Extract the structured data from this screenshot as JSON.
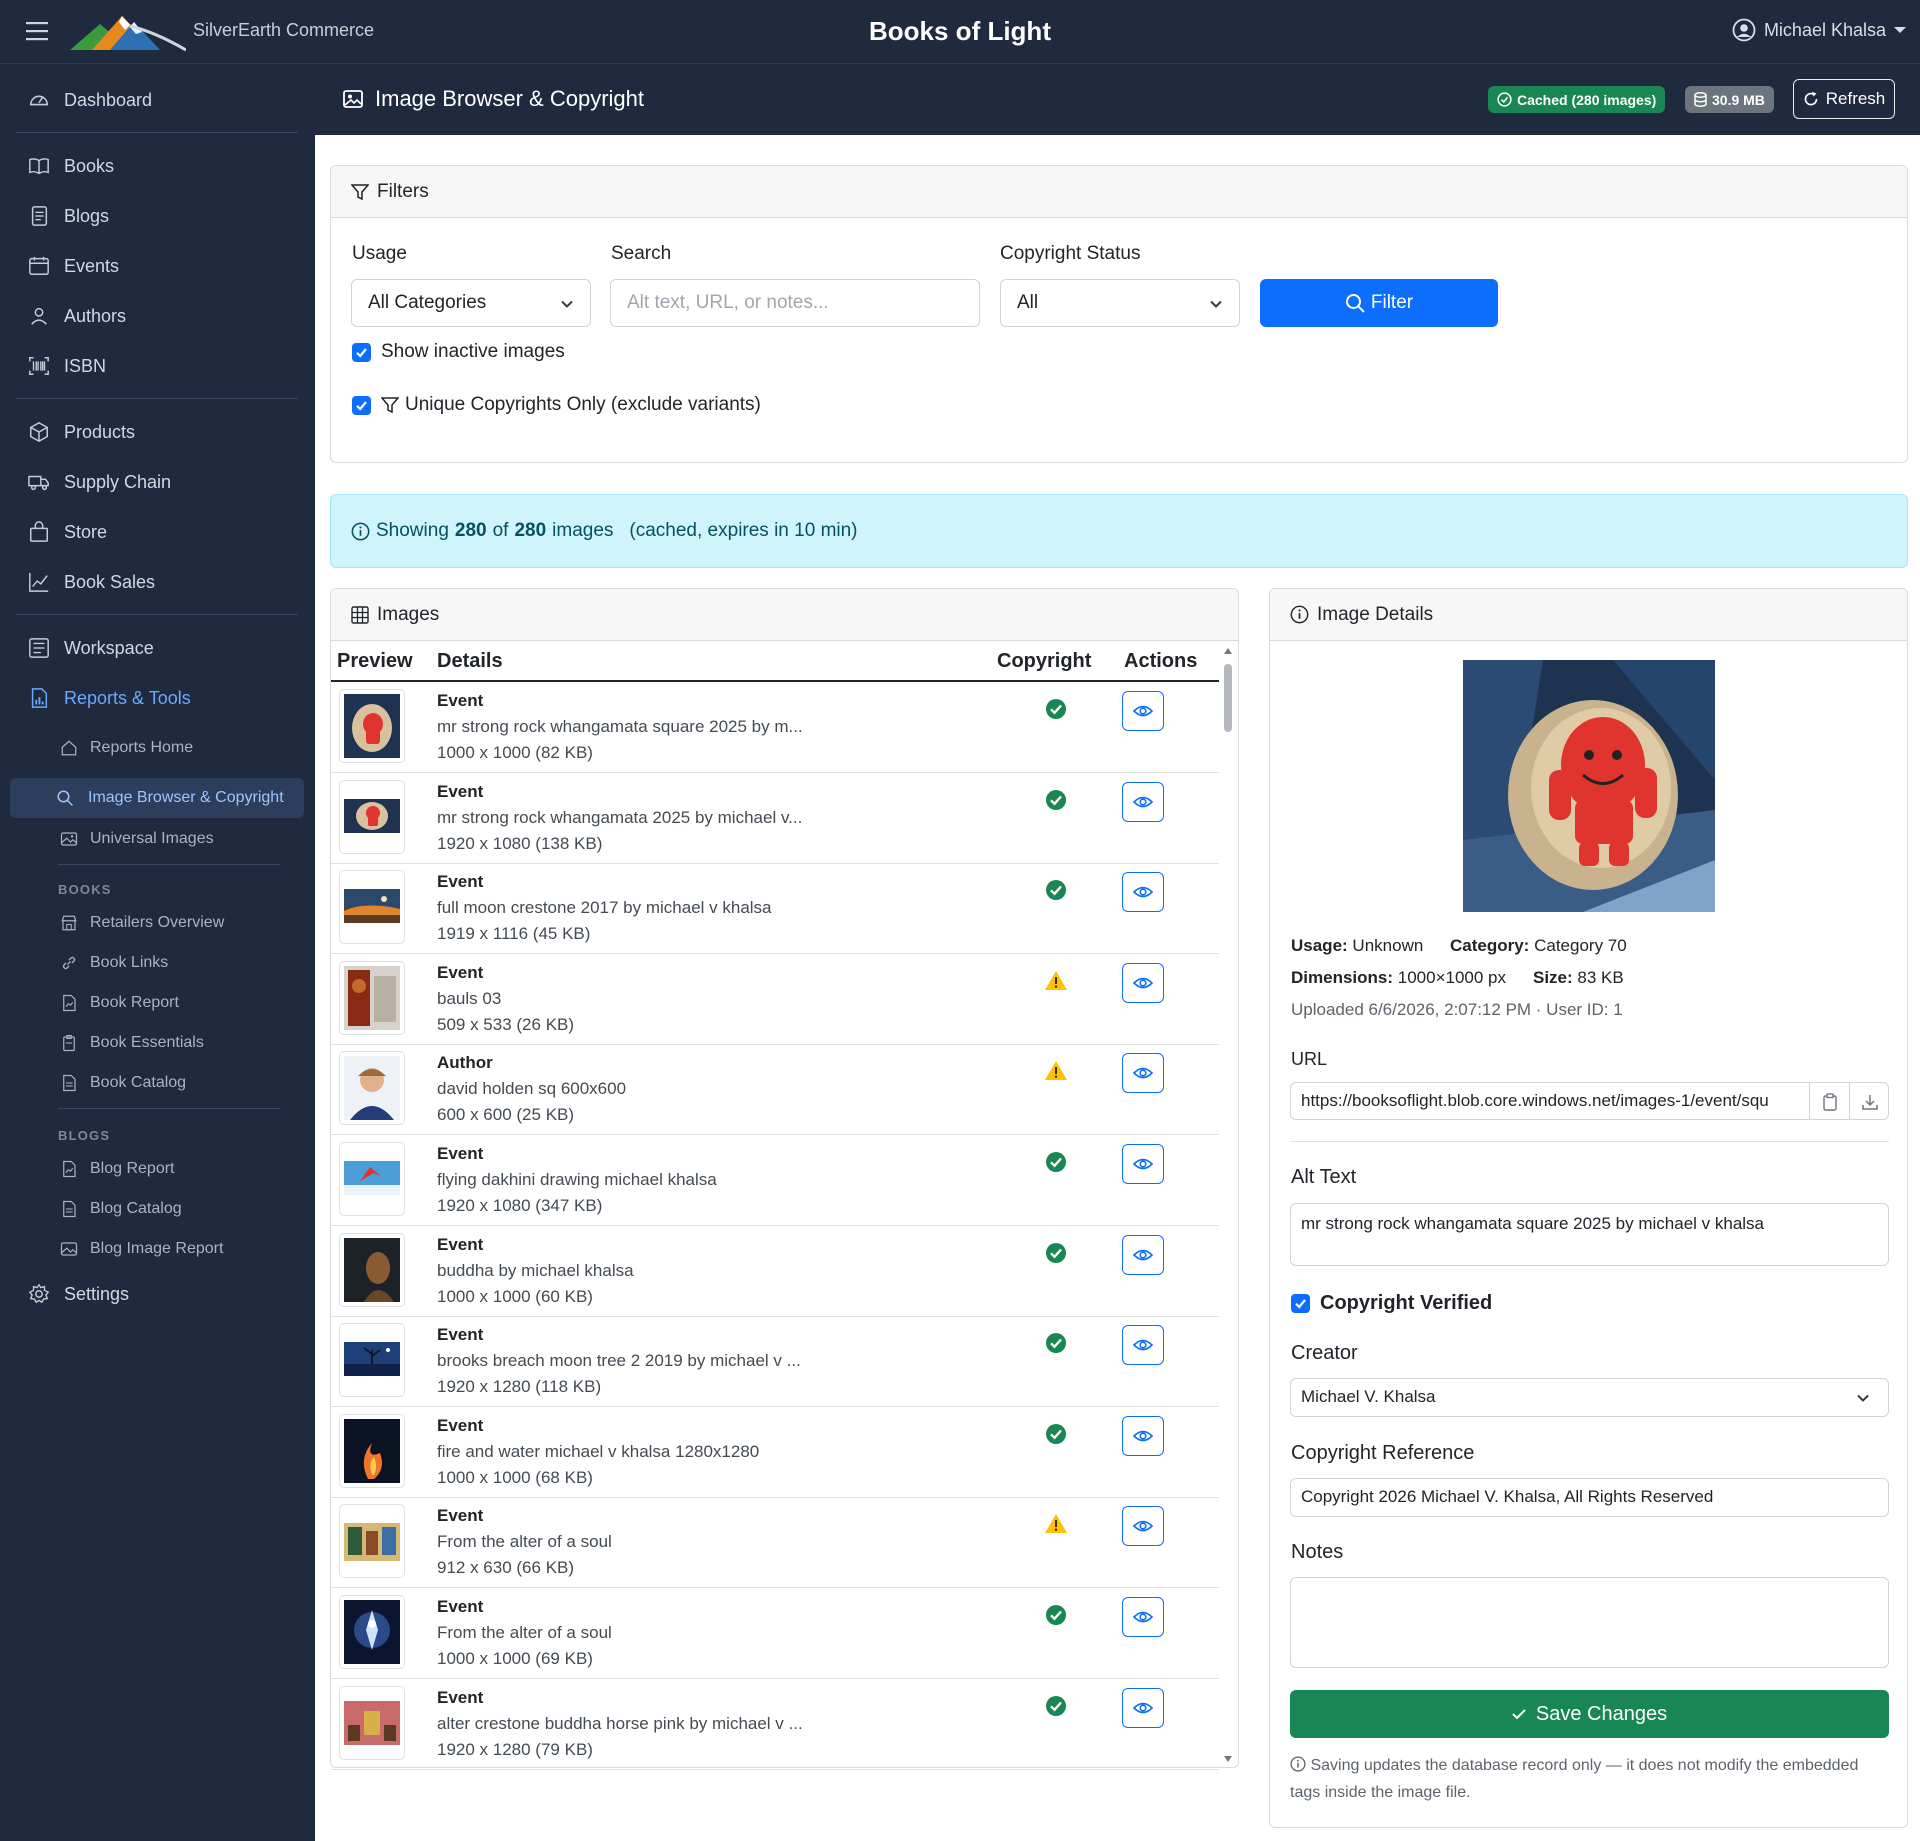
{
  "app": {
    "brand": "SilverEarth Commerce",
    "title": "Books of Light",
    "user": "Michael Khalsa"
  },
  "sidebar": {
    "items": [
      {
        "label": "Dashboard",
        "icon": "gauge-icon"
      },
      {
        "label": "Books",
        "icon": "book-icon"
      },
      {
        "label": "Blogs",
        "icon": "journal-icon"
      },
      {
        "label": "Events",
        "icon": "calendar-icon"
      },
      {
        "label": "Authors",
        "icon": "person-icon"
      },
      {
        "label": "ISBN",
        "icon": "barcode-icon"
      },
      {
        "label": "Products",
        "icon": "box-icon"
      },
      {
        "label": "Supply Chain",
        "icon": "truck-icon"
      },
      {
        "label": "Store",
        "icon": "bag-icon"
      },
      {
        "label": "Book Sales",
        "icon": "graph-icon"
      },
      {
        "label": "Workspace",
        "icon": "layout-icon"
      },
      {
        "label": "Reports & Tools",
        "icon": "report-icon"
      },
      {
        "label": "Settings",
        "icon": "gear-icon"
      }
    ],
    "sub_items": [
      {
        "label": "Reports Home",
        "icon": "house-icon"
      },
      {
        "label": "Image Browser & Copyright",
        "icon": "search-icon"
      },
      {
        "label": "Universal Images",
        "icon": "images-icon"
      }
    ],
    "books_section": {
      "title": "BOOKS",
      "items": [
        "Retailers Overview",
        "Book Links",
        "Book Report",
        "Book Essentials",
        "Book Catalog"
      ]
    },
    "blogs_section": {
      "title": "BLOGS",
      "items": [
        "Blog Report",
        "Blog Catalog",
        "Blog Image Report"
      ]
    }
  },
  "page": {
    "title": "Image Browser & Copyright",
    "cached_badge": "Cached (280 images)",
    "size_badge": "30.9 MB",
    "refresh_label": "Refresh"
  },
  "filters": {
    "header": "Filters",
    "usage_label": "Usage",
    "usage_value": "All Categories",
    "search_label": "Search",
    "search_placeholder": "Alt text, URL, or notes...",
    "copyright_label": "Copyright Status",
    "copyright_value": "All",
    "filter_button": "Filter",
    "show_inactive": "Show inactive images",
    "unique_only": "Unique Copyrights Only (exclude variants)"
  },
  "status": {
    "prefix": "Showing",
    "shown": "280",
    "of": "of",
    "total": "280",
    "suffix": "images",
    "cache_note": "(cached, expires in 10 min)"
  },
  "images": {
    "header": "Images",
    "columns": [
      "Preview",
      "Details",
      "Copyright",
      "Actions"
    ],
    "rows": [
      {
        "category": "Event",
        "name": "mr strong rock whangamata square 2025 by m...",
        "dims": "1000 x 1000 (82 KB)",
        "copyright": "verified",
        "thumb": "red-rock"
      },
      {
        "category": "Event",
        "name": "mr strong rock whangamata 2025 by michael v...",
        "dims": "1920 x 1080 (138 KB)",
        "copyright": "verified",
        "thumb": "red-rock-wide"
      },
      {
        "category": "Event",
        "name": "full moon crestone 2017 by michael v khalsa",
        "dims": "1919 x 1116 (45 KB)",
        "copyright": "verified",
        "thumb": "sunset"
      },
      {
        "category": "Event",
        "name": "bauls 03",
        "dims": "509 x 533 (26 KB)",
        "copyright": "warning",
        "thumb": "bauls"
      },
      {
        "category": "Author",
        "name": "david holden sq 600x600",
        "dims": "600 x 600 (25 KB)",
        "copyright": "warning",
        "thumb": "portrait"
      },
      {
        "category": "Event",
        "name": "flying dakhini drawing michael khalsa",
        "dims": "1920 x 1080 (347 KB)",
        "copyright": "verified",
        "thumb": "sky"
      },
      {
        "category": "Event",
        "name": "buddha by michael khalsa",
        "dims": "1000 x 1000 (60 KB)",
        "copyright": "verified",
        "thumb": "buddha"
      },
      {
        "category": "Event",
        "name": "brooks breach moon tree 2 2019 by michael v ...",
        "dims": "1920 x 1280 (118 KB)",
        "copyright": "verified",
        "thumb": "moon-tree"
      },
      {
        "category": "Event",
        "name": "fire and water michael v khalsa 1280x1280",
        "dims": "1000 x 1000 (68 KB)",
        "copyright": "verified",
        "thumb": "fire"
      },
      {
        "category": "Event",
        "name": "From the alter of a soul",
        "dims": "912 x 630 (66 KB)",
        "copyright": "warning",
        "thumb": "painting"
      },
      {
        "category": "Event",
        "name": "From the alter of a soul",
        "dims": "1000 x 1000 (69 KB)",
        "copyright": "verified",
        "thumb": "deity"
      },
      {
        "category": "Event",
        "name": "alter crestone buddha horse pink by michael v ...",
        "dims": "1920 x 1280 (79 KB)",
        "copyright": "verified",
        "thumb": "altar"
      }
    ]
  },
  "details": {
    "header": "Image Details",
    "usage_label": "Usage:",
    "usage": "Unknown",
    "category_label": "Category:",
    "category": "Category 70",
    "dimensions_label": "Dimensions:",
    "dimensions": "1000×1000 px",
    "size_label": "Size:",
    "size": "83 KB",
    "uploaded": "Uploaded 6/6/2026, 2:07:12 PM · User ID: 1",
    "url_label": "URL",
    "url": "https://booksoflight.blob.core.windows.net/images-1/event/squ",
    "alt_label": "Alt Text",
    "alt": "mr strong rock whangamata square 2025 by michael v khalsa",
    "verified_label": "Copyright Verified",
    "creator_label": "Creator",
    "creator": "Michael V. Khalsa",
    "reference_label": "Copyright Reference",
    "reference": "Copyright 2026 Michael V. Khalsa, All Rights Reserved",
    "notes_label": "Notes",
    "notes": "",
    "save_label": "Save Changes",
    "footnote": "Saving updates the database record only — it does not modify the embedded tags inside the image file."
  },
  "colors": {
    "primary": "#0d6efd",
    "success": "#198754",
    "warning": "#ffc107",
    "sidebar": "#1f2a3e",
    "info_bg": "#cff4fc"
  }
}
